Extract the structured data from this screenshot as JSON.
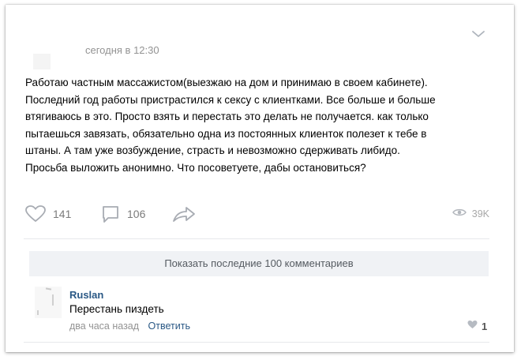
{
  "post": {
    "timestamp": "сегодня в 12:30",
    "text": "Работаю частным массажистом(выезжаю на дом и принимаю в своем кабинете).\nПоследний год работы пристрастился к сексу с клиентками. Все больше и больше\nвтягиваюсь в это. Просто взять и перестать это делать не получается. как только\nпытаешься завязать, обязательно одна из постоянных клиенток полезет к тебе в\nштаны. А там уже возбуждение, страсть и невозможно сдерживать либидо.\nПросьба выложить анонимно. Что посоветуете, дабы остановиться?",
    "likes": "141",
    "comments": "106",
    "views": "39K"
  },
  "show_comments_label": "Показать последние 100 комментариев",
  "comment": {
    "author": "Ruslan",
    "text": "Перестань пиздеть",
    "time": "два часа назад",
    "reply_label": "Ответить",
    "likes": "1"
  },
  "icons": {
    "menu": "chevron-down-icon",
    "like": "heart-icon",
    "comment": "speech-bubble-icon",
    "share": "share-arrow-icon",
    "views": "eye-icon",
    "comment_like": "heart-icon"
  },
  "colors": {
    "link": "#2a5885",
    "muted": "#939393",
    "icon": "#a8acb3",
    "button_bg": "#f0f2f5"
  }
}
